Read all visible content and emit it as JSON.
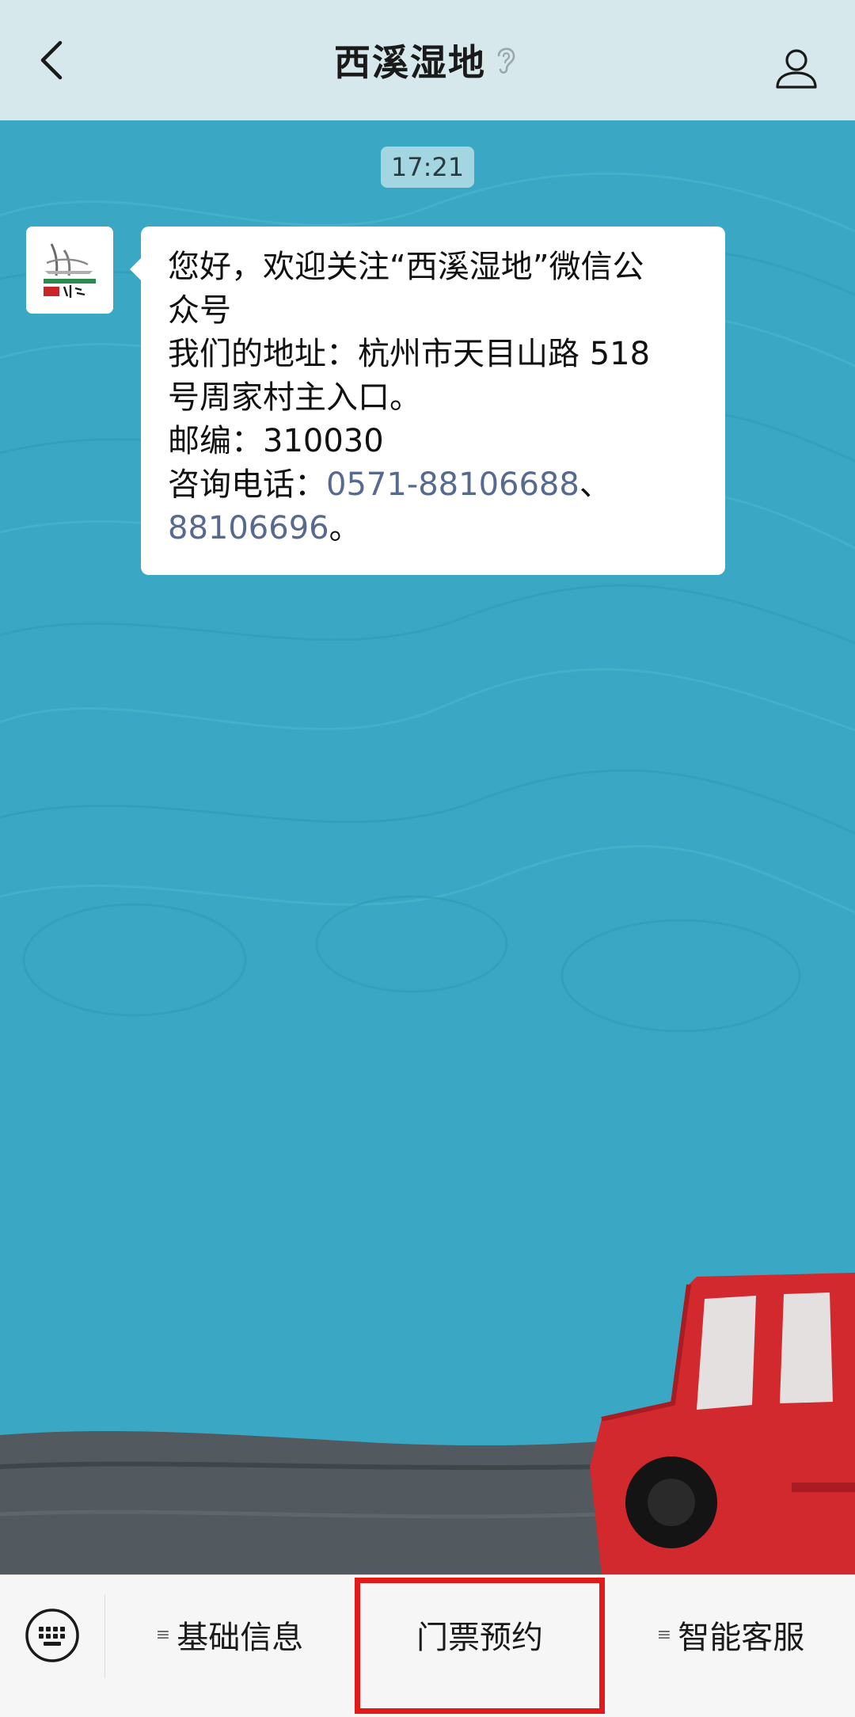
{
  "header": {
    "title": "西溪湿地",
    "back_icon": "chevron-left-icon",
    "listen_icon": "ear-icon",
    "profile_icon": "person-icon"
  },
  "chat": {
    "timestamp": "17:21",
    "message": {
      "line1": "您好，欢迎关注“西溪湿地”微信公",
      "line2": "众号",
      "line3": "我们的地址：杭州市天目山路 518",
      "line4": "号周家村主入口。",
      "line5": "邮编：310030",
      "line6_prefix": "咨询电话：",
      "phone1": "0571-88106688",
      "line6_sep": "、",
      "phone2": "88106696",
      "line7_suffix": "。"
    }
  },
  "menu": {
    "keyboard_icon": "keyboard-icon",
    "items": [
      {
        "label": "基础信息",
        "has_submenu": true
      },
      {
        "label": "门票预约",
        "has_submenu": false
      },
      {
        "label": "智能客服",
        "has_submenu": true
      }
    ]
  },
  "colors": {
    "header_bg": "#d6e8ec",
    "chat_bg": "#3aa8c4",
    "link": "#57698f",
    "highlight": "#e11919",
    "menu_bg": "#f6f6f6"
  }
}
